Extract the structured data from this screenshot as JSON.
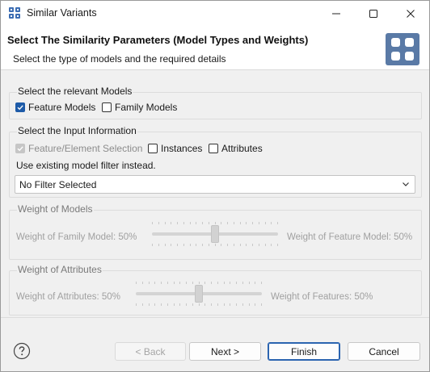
{
  "window": {
    "title": "Similar Variants"
  },
  "banner": {
    "title": "Select The Similarity Parameters (Model Types and Weights)",
    "subtitle": "Select the type of models and the required details"
  },
  "models_group": {
    "label": "Select the relevant Models",
    "options": [
      {
        "label": "Feature Models",
        "checked": true
      },
      {
        "label": "Family Models",
        "checked": false
      }
    ]
  },
  "input_group": {
    "label": "Select the Input Information",
    "options": [
      {
        "label": "Feature/Element Selection",
        "checked": true,
        "disabled": true
      },
      {
        "label": "Instances",
        "checked": false
      },
      {
        "label": "Attributes",
        "checked": false
      }
    ],
    "filter_text": "Use existing model filter instead.",
    "filter_select": {
      "value": "No Filter Selected"
    }
  },
  "weight_models": {
    "label": "Weight of Models",
    "left_label": "Weight of Family Model: 50%",
    "right_label": "Weight of Feature Model: 50%",
    "value_percent": 50
  },
  "weight_attributes": {
    "label": "Weight of Attributes",
    "left_label": "Weight of Attributes: 50%",
    "right_label": "Weight of Features: 50%",
    "value_percent": 50
  },
  "footer": {
    "back_label": "< Back",
    "next_label": "Next >",
    "finish_label": "Finish",
    "cancel_label": "Cancel"
  },
  "colors": {
    "accent": "#1e5ba8",
    "banner_icon": "#5a7aa6"
  }
}
